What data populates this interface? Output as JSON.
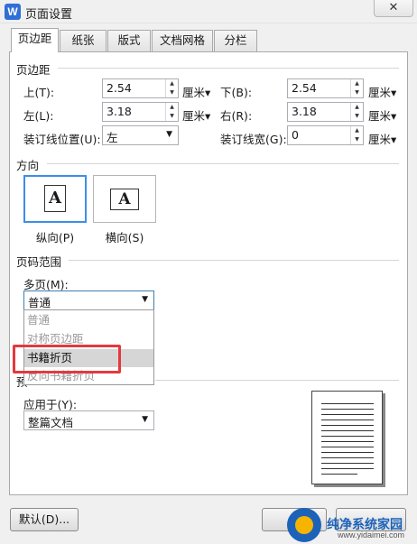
{
  "window": {
    "title": "页面设置",
    "app_icon": "W",
    "close_glyph": "✕"
  },
  "tabs": [
    {
      "label": "页边距",
      "active": true
    },
    {
      "label": "纸张"
    },
    {
      "label": "版式"
    },
    {
      "label": "文档网格"
    },
    {
      "label": "分栏"
    }
  ],
  "margins": {
    "group_title": "页边距",
    "top": {
      "label": "上(T):",
      "value": "2.54",
      "unit": "厘米▾"
    },
    "bottom": {
      "label": "下(B):",
      "value": "2.54",
      "unit": "厘米▾"
    },
    "left": {
      "label": "左(L):",
      "value": "3.18",
      "unit": "厘米▾"
    },
    "right": {
      "label": "右(R):",
      "value": "3.18",
      "unit": "厘米▾"
    },
    "gutter_position": {
      "label": "装订线位置(U):",
      "value": "左"
    },
    "gutter_width": {
      "label": "装订线宽(G):",
      "value": "0",
      "unit": "厘米▾"
    }
  },
  "orientation": {
    "group_title": "方向",
    "portrait_label": "纵向(P)",
    "landscape_label": "横向(S)",
    "glyph": "A",
    "selected": "portrait"
  },
  "page_range": {
    "group_title": "页码范围",
    "multiple_pages_label": "多页(M):",
    "multiple_pages_value": "普通",
    "options": [
      "普通",
      "对称页边距",
      "书籍折页",
      "反向书籍折页"
    ],
    "highlighted_option": "书籍折页"
  },
  "preview": {
    "group_title_partial": "预",
    "apply_to_label": "应用于(Y):",
    "apply_to_value": "整篇文档"
  },
  "footer": {
    "default_button": "默认(D)..."
  },
  "watermark": {
    "name": "纯净系统家园",
    "url": "www.yidaimei.com"
  },
  "colors": {
    "accent": "#3d8ee8",
    "highlight_box": "#e4393c",
    "watermark_blue": "#1c62b9"
  }
}
